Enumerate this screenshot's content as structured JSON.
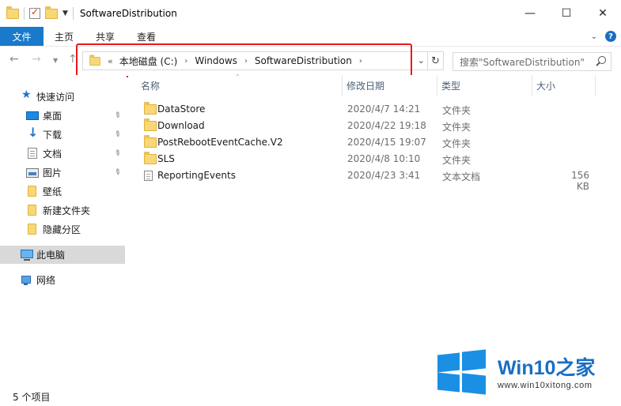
{
  "window": {
    "title": "SoftwareDistribution",
    "min_glyph": "—",
    "max_glyph": "☐",
    "close_glyph": "✕"
  },
  "ribbon": {
    "tabs": [
      "文件",
      "主页",
      "共享",
      "查看"
    ]
  },
  "nav": {
    "back_glyph": "←",
    "forward_glyph": "→",
    "recent_glyph": "⌄",
    "up_glyph": "↑"
  },
  "address": {
    "lead": "«",
    "crumbs": [
      "本地磁盘 (C:)",
      "Windows",
      "SoftwareDistribution"
    ],
    "arrow": "›",
    "dropdown_glyph": "⌄",
    "refresh_glyph": "↻"
  },
  "search": {
    "placeholder": "搜索\"SoftwareDistribution\""
  },
  "sidebar": {
    "items": [
      {
        "label": "快速访问",
        "icon": "star-icon",
        "pinned": false
      },
      {
        "label": "桌面",
        "icon": "desktop-icon",
        "pinned": true
      },
      {
        "label": "下载",
        "icon": "download-icon",
        "pinned": true
      },
      {
        "label": "文档",
        "icon": "document-icon",
        "pinned": true
      },
      {
        "label": "图片",
        "icon": "picture-icon",
        "pinned": true
      },
      {
        "label": "壁纸",
        "icon": "folder-icon",
        "pinned": false
      },
      {
        "label": "新建文件夹",
        "icon": "folder-icon",
        "pinned": false
      },
      {
        "label": "隐藏分区",
        "icon": "folder-icon",
        "pinned": false
      },
      {
        "label": "此电脑",
        "icon": "computer-icon",
        "pinned": false,
        "selected": true
      },
      {
        "label": "网络",
        "icon": "network-icon",
        "pinned": false
      }
    ],
    "pin_glyph": "📌"
  },
  "columns": {
    "name": "名称",
    "date": "修改日期",
    "type": "类型",
    "size": "大小"
  },
  "files": [
    {
      "name": "DataStore",
      "date": "2020/4/7 14:21",
      "type": "文件夹",
      "size": "",
      "icon": "folder-icon"
    },
    {
      "name": "Download",
      "date": "2020/4/22 19:18",
      "type": "文件夹",
      "size": "",
      "icon": "folder-icon"
    },
    {
      "name": "PostRebootEventCache.V2",
      "date": "2020/4/15 19:07",
      "type": "文件夹",
      "size": "",
      "icon": "folder-icon"
    },
    {
      "name": "SLS",
      "date": "2020/4/8 10:10",
      "type": "文件夹",
      "size": "",
      "icon": "folder-icon"
    },
    {
      "name": "ReportingEvents",
      "date": "2020/4/23 3:41",
      "type": "文本文档",
      "size": "156 KB",
      "icon": "text-file-icon"
    }
  ],
  "status": {
    "count_text": "5 个项目"
  },
  "watermark": {
    "brand": "Win10",
    "brand_suffix": "之家",
    "url": "www.win10xitong.com",
    "color": "#1a8fe3"
  }
}
